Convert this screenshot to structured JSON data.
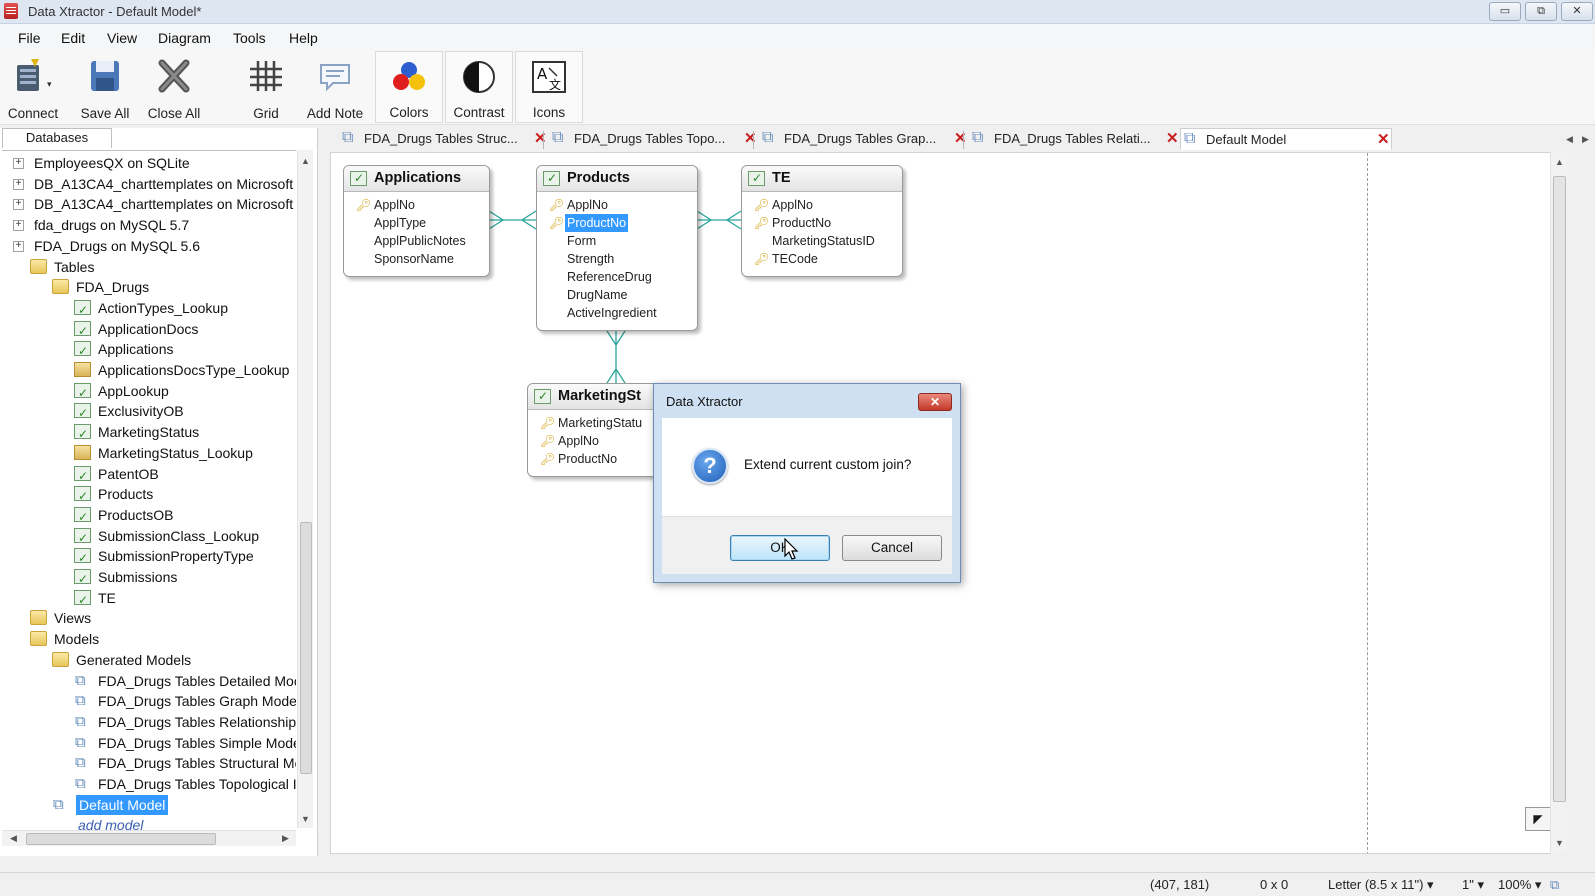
{
  "window": {
    "title": "Data Xtractor - Default Model*",
    "minimize": "▭",
    "maximize": "⧉",
    "close": "✕"
  },
  "menu": [
    "File",
    "Edit",
    "View",
    "Diagram",
    "Tools",
    "Help"
  ],
  "toolbar": {
    "connect": "Connect",
    "save_all": "Save All",
    "close_all": "Close All",
    "grid": "Grid",
    "add_note": "Add Note",
    "colors": "Colors",
    "contrast": "Contrast",
    "icons": "Icons"
  },
  "left_panel": {
    "tab": "Databases",
    "tree": [
      {
        "label": "EmployeesQX on SQLite",
        "icon": "database-icon",
        "expander": "+"
      },
      {
        "label": "DB_A13CA4_charttemplates on Microsoft S",
        "icon": "database-icon",
        "expander": "+"
      },
      {
        "label": "DB_A13CA4_charttemplates on Microsoft S",
        "icon": "database-icon",
        "expander": "+"
      },
      {
        "label": "fda_drugs on MySQL 5.7",
        "icon": "database-icon",
        "expander": "+"
      },
      {
        "label": "FDA_Drugs on MySQL 5.6",
        "icon": "database-icon",
        "expander": "+"
      },
      {
        "label": "Tables",
        "icon": "folder-icon"
      },
      {
        "label": "FDA_Drugs",
        "icon": "folder-icon"
      },
      {
        "label": "ActionTypes_Lookup",
        "icon": "table-icon"
      },
      {
        "label": "ApplicationDocs",
        "icon": "table-icon"
      },
      {
        "label": "Applications",
        "icon": "table-icon"
      },
      {
        "label": "ApplicationsDocsType_Lookup",
        "icon": "lookup-table-icon"
      },
      {
        "label": "AppLookup",
        "icon": "table-icon"
      },
      {
        "label": "ExclusivityOB",
        "icon": "table-icon"
      },
      {
        "label": "MarketingStatus",
        "icon": "table-icon"
      },
      {
        "label": "MarketingStatus_Lookup",
        "icon": "lookup-table-icon"
      },
      {
        "label": "PatentOB",
        "icon": "table-icon"
      },
      {
        "label": "Products",
        "icon": "table-icon"
      },
      {
        "label": "ProductsOB",
        "icon": "table-icon"
      },
      {
        "label": "SubmissionClass_Lookup",
        "icon": "table-icon"
      },
      {
        "label": "SubmissionPropertyType",
        "icon": "table-icon"
      },
      {
        "label": "Submissions",
        "icon": "table-icon"
      },
      {
        "label": "TE",
        "icon": "table-icon"
      },
      {
        "label": "Views",
        "icon": "folder-icon"
      },
      {
        "label": "Models",
        "icon": "folder-icon"
      },
      {
        "label": "Generated Models",
        "icon": "folder-icon"
      },
      {
        "label": "FDA_Drugs Tables Detailed Moc",
        "icon": "model-icon"
      },
      {
        "label": "FDA_Drugs Tables Graph Model",
        "icon": "model-icon"
      },
      {
        "label": "FDA_Drugs Tables Relationship",
        "icon": "model-icon"
      },
      {
        "label": "FDA_Drugs Tables Simple Mode",
        "icon": "model-icon"
      },
      {
        "label": "FDA_Drugs Tables Structural Mc",
        "icon": "model-icon"
      },
      {
        "label": "FDA_Drugs Tables Topological I",
        "icon": "model-icon"
      },
      {
        "label": "Default Model",
        "icon": "model-icon",
        "selected": true
      },
      {
        "label": "add model",
        "icon": "",
        "link": true
      }
    ]
  },
  "tabs": [
    {
      "label": "FDA_Drugs Tables Struc..."
    },
    {
      "label": "FDA_Drugs Tables Topo..."
    },
    {
      "label": "FDA_Drugs Tables Grap..."
    },
    {
      "label": "FDA_Drugs Tables Relati..."
    },
    {
      "label": "Default Model",
      "active": true
    }
  ],
  "entities": {
    "applications": {
      "title": "Applications",
      "fields": [
        {
          "name": "ApplNo",
          "key": true
        },
        {
          "name": "ApplType",
          "key": false
        },
        {
          "name": "ApplPublicNotes",
          "key": false
        },
        {
          "name": "SponsorName",
          "key": false
        }
      ]
    },
    "products": {
      "title": "Products",
      "fields": [
        {
          "name": "ApplNo",
          "key": true
        },
        {
          "name": "ProductNo",
          "key": true,
          "selected": true
        },
        {
          "name": "Form",
          "key": false
        },
        {
          "name": "Strength",
          "key": false
        },
        {
          "name": "ReferenceDrug",
          "key": false
        },
        {
          "name": "DrugName",
          "key": false
        },
        {
          "name": "ActiveIngredient",
          "key": false
        }
      ]
    },
    "te": {
      "title": "TE",
      "fields": [
        {
          "name": "ApplNo",
          "key": true
        },
        {
          "name": "ProductNo",
          "key": true
        },
        {
          "name": "MarketingStatusID",
          "key": false
        },
        {
          "name": "TECode",
          "key": true
        }
      ]
    },
    "marketing": {
      "title": "MarketingSt",
      "fields": [
        {
          "name": "MarketingStatu",
          "key": true
        },
        {
          "name": "ApplNo",
          "key": true
        },
        {
          "name": "ProductNo",
          "key": true
        }
      ]
    }
  },
  "dialog": {
    "title": "Data Xtractor",
    "close": "✕",
    "message": "Extend current custom join?",
    "icon": "?",
    "ok": "OK",
    "cancel": "Cancel"
  },
  "statusbar": {
    "coords": "(407, 181)",
    "size": "0 x 0",
    "paper": "Letter (8.5 x 11\") ▾",
    "margin": "1\" ▾",
    "zoom": "100% ▾"
  }
}
